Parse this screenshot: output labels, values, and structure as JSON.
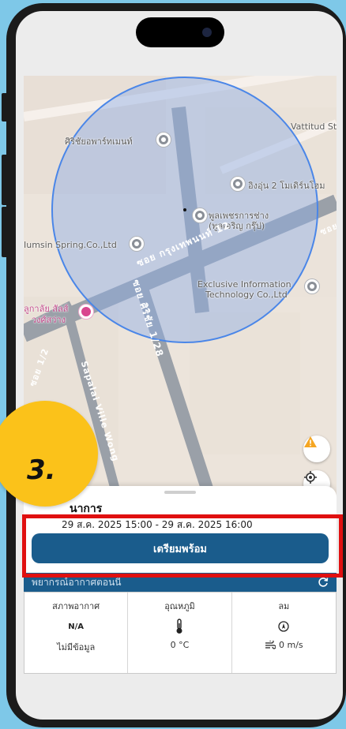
{
  "map": {
    "labels": {
      "poi_1": "ศิริชัยอพาร์ทเมนท์",
      "poi_2": "อิงอุ่น 2 โมเดิร์นโฮม",
      "poi_3": "พูลเพชรการช่าง",
      "poi_3b": "(พูลเจริญ กรุ๊ป)",
      "poi_4": "Iumsin Spring.Co.,Ltd",
      "poi_5": "Exclusive Information",
      "poi_5b": "Technology Co.,Ltd",
      "poi_6": "Vattitud St",
      "poi_7": "ลูกาลัย สัลส์",
      "poi_7b": "วงศ์สว่าง",
      "road_1": "ซอย กรุงเทพนนท์ 12",
      "road_2": "ซอย ศิริชัย 1/28",
      "road_3": "Sapalai Ville Wong",
      "road_4": "ซอย 1/2",
      "road_5": "ซอย"
    },
    "circle_color": "#4a86e8"
  },
  "sheet": {
    "title": "นาการ",
    "time_range": "29 ส.ค. 2025 15:00 - 29 ส.ค. 2025 16:00",
    "ready_button": "เตรียมพร้อม",
    "forecast_header": "พยากรณ์อากาศตอนนี้",
    "columns": [
      {
        "heading": "สภาพอากาศ",
        "value": "N/A",
        "sub": "ไม่มีข้อมูล"
      },
      {
        "heading": "อุณหภูมิ",
        "value": "",
        "sub": "0 °C"
      },
      {
        "heading": "ลม",
        "value": "",
        "sub": "0 m/s"
      }
    ]
  },
  "annotation": {
    "step_number": "3.",
    "step_color": "#fbc21a",
    "highlight_color": "#e01010"
  }
}
